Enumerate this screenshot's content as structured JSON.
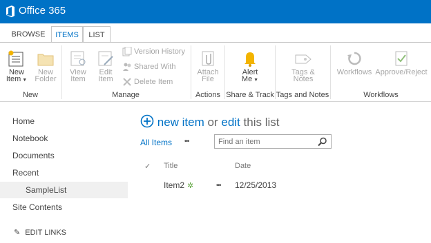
{
  "suite": {
    "brand": "Office 365"
  },
  "tabs": [
    {
      "label": "BROWSE"
    },
    {
      "label": "ITEMS"
    },
    {
      "label": "LIST"
    }
  ],
  "ribbon": {
    "new_item": {
      "l1": "New",
      "l2": "Item"
    },
    "new_folder": {
      "l1": "New",
      "l2": "Folder"
    },
    "group_new": "New",
    "view_item": {
      "l1": "View",
      "l2": "Item"
    },
    "edit_item": {
      "l1": "Edit",
      "l2": "Item"
    },
    "version_history": "Version History",
    "shared_with": "Shared With",
    "delete_item": "Delete Item",
    "group_manage": "Manage",
    "attach_file": {
      "l1": "Attach",
      "l2": "File"
    },
    "group_actions": "Actions",
    "alert_me": {
      "l1": "Alert",
      "l2": "Me"
    },
    "group_share_track": "Share & Track",
    "tags_notes": {
      "l1": "Tags &",
      "l2": "Notes"
    },
    "group_tags_notes": "Tags and Notes",
    "workflows": "Workflows",
    "approve_reject": "Approve/Reject",
    "group_workflows": "Workflows"
  },
  "nav": {
    "home": "Home",
    "notebook": "Notebook",
    "documents": "Documents",
    "recent": "Recent",
    "sample_list": "SampleList",
    "site_contents": "Site Contents",
    "edit_links": "EDIT LINKS"
  },
  "main": {
    "new_item": "new item",
    "or": "or",
    "edit": "edit",
    "this_list": "this list",
    "all_items": "All Items",
    "ellipsis": "•••",
    "search_placeholder": "Find an item",
    "columns": {
      "check": "✓",
      "title": "Title",
      "date": "Date"
    },
    "rows": [
      {
        "title": "Item2",
        "date": "12/25/2013"
      }
    ]
  },
  "colors": {
    "suite_bar": "#0072c6",
    "accent": "#0072c6",
    "new_badge": "#5ba43a"
  }
}
